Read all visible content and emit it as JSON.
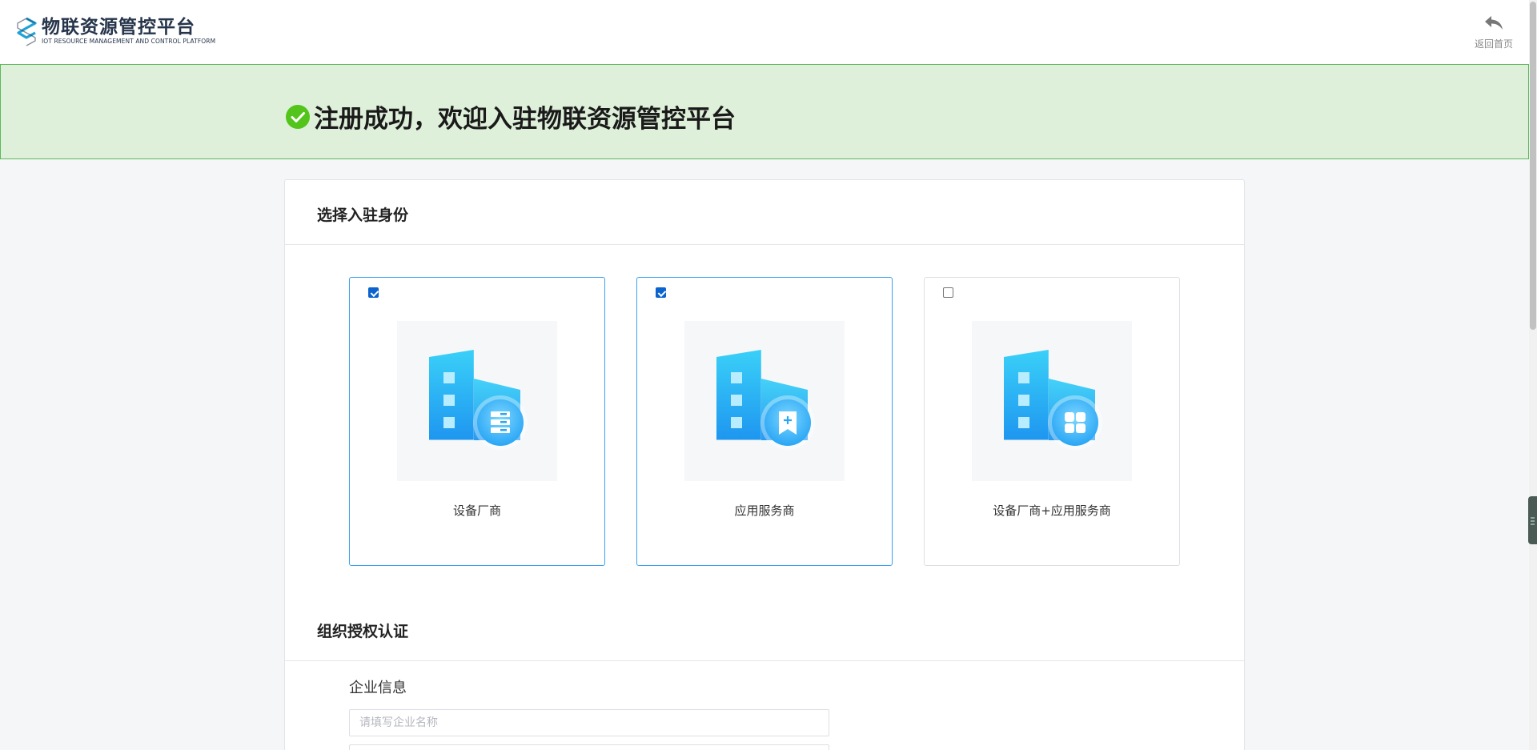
{
  "header": {
    "logo": {
      "title": "物联资源管控平台",
      "subtitle": "IOT RESOURCE MANAGEMENT AND CONTROL PLATFORM"
    },
    "back_home": {
      "label": "返回首页",
      "icon": "undo-arrow-icon"
    }
  },
  "banner": {
    "icon": "check-circle-icon",
    "message": "注册成功，欢迎入驻物联资源管控平台",
    "color": "#5cb85c"
  },
  "identity_section": {
    "title": "选择入驻身份",
    "options": [
      {
        "label": "设备厂商",
        "checked": true,
        "icon": "server-building-icon"
      },
      {
        "label": "应用服务商",
        "checked": true,
        "icon": "bookmark-building-icon"
      },
      {
        "label": "设备厂商+应用服务商",
        "checked": false,
        "icon": "grid-building-icon"
      }
    ]
  },
  "auth_section": {
    "title": "组织授权认证",
    "company_info": {
      "title": "企业信息",
      "company_name": {
        "value": "",
        "placeholder": "请填写企业名称"
      },
      "second_field": {
        "value": "",
        "placeholder": ""
      }
    }
  },
  "colors": {
    "accent": "#3ca1f2",
    "banner_bg": "#dff0da",
    "checkbox": "#0b63ce"
  }
}
